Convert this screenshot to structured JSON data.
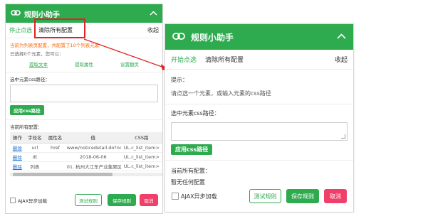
{
  "before": {
    "title": "规则小助手",
    "toolbar": {
      "stop": "停止点选",
      "clear": "清除所有配置",
      "collapse": "收起"
    },
    "warning": "当前为列表页配置，共配置了10个列表元素",
    "selected": "已选择0个元素，您可以：",
    "actions": [
      "提取文本",
      "提取属性",
      "设置翻页"
    ],
    "css_label": "选中元素css路径：",
    "apply": "应用css路径",
    "current_label": "当前所有配置：",
    "table": {
      "headers": [
        "操作",
        "字段名",
        "属性名",
        "值",
        "CSS路"
      ],
      "rows": [
        [
          "删除",
          "url",
          "href",
          "www/noticedetail.do?no...",
          "UL.c_list_item>"
        ],
        [
          "删除",
          "dt",
          "",
          "2018-06-06",
          "UL.c_list_item>"
        ],
        [
          "删除",
          "列表",
          "",
          "01. 杭州大江东产业集聚区...",
          "UL.c_list_item>"
        ]
      ]
    },
    "ajax": "AJAX异步加载",
    "buttons": {
      "test": "测试规则",
      "save": "保存规则",
      "cancel": "取消"
    }
  },
  "after": {
    "title": "规则小助手",
    "toolbar": {
      "start": "开始点选",
      "clear": "清除所有配置",
      "collapse": "收起"
    },
    "tip_label": "提示：",
    "tip": "请点选一个元素，或输入元素的css路径",
    "css_label": "选中元素css路径：",
    "apply": "应用css路径",
    "current_label": "当前所有配置：",
    "none": "暂无任何配置",
    "ajax": "AJAX异步加载",
    "buttons": {
      "test": "测试规则",
      "save": "保存规则",
      "cancel": "取消"
    }
  },
  "colors": {
    "brand": "#2eaa4f",
    "warning": "#ff6600",
    "cancel": "#f0406a",
    "highlight": "#e02424"
  },
  "icons": {
    "logo": "chain-link-icon",
    "collapse": "chevron-up-icon"
  }
}
